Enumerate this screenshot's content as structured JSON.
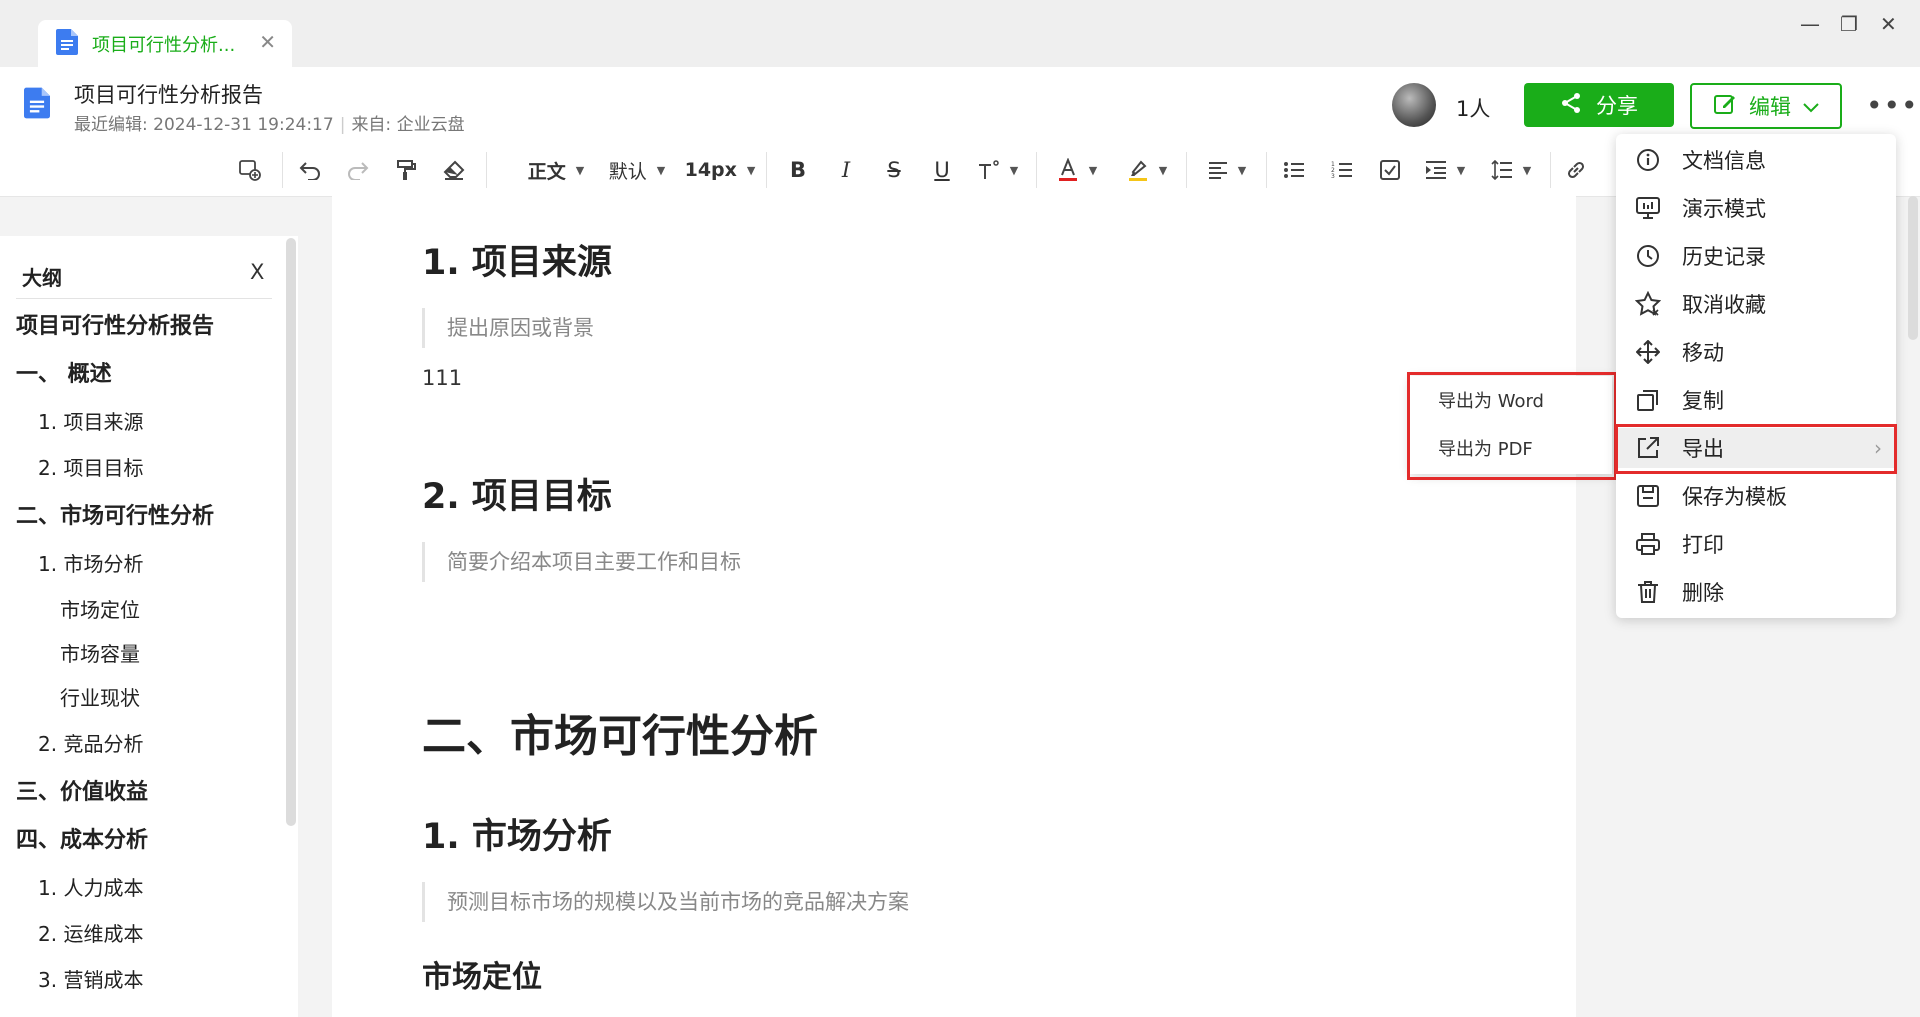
{
  "tab": {
    "title": "项目可行性分析...",
    "close": "✕"
  },
  "window": {
    "minimize": "—",
    "restore": "❐",
    "close": "✕"
  },
  "header": {
    "title": "项目可行性分析报告",
    "meta_edit_label": "最近编辑:",
    "meta_edit_time": "2024-12-31 19:24:17",
    "meta_source": "来自: 企业云盘",
    "people": "1人",
    "share": "分享",
    "edit": "编辑",
    "more": "•••"
  },
  "toolbar": {
    "style": "正文",
    "font": "默认",
    "size": "14px"
  },
  "outline": {
    "heading": "大纲",
    "close": "X",
    "items": [
      {
        "label": "项目可行性分析报告",
        "level": 0
      },
      {
        "label": "一、 概述",
        "level": 0
      },
      {
        "label": "1. 项目来源",
        "level": 1
      },
      {
        "label": "2. 项目目标",
        "level": 1
      },
      {
        "label": "二、市场可行性分析",
        "level": 0
      },
      {
        "label": "1. 市场分析",
        "level": 1
      },
      {
        "label": "市场定位",
        "level": 2
      },
      {
        "label": "市场容量",
        "level": 2
      },
      {
        "label": "行业现状",
        "level": 2
      },
      {
        "label": "2. 竞品分析",
        "level": 1
      },
      {
        "label": "三、价值收益",
        "level": 0
      },
      {
        "label": "四、成本分析",
        "level": 0
      },
      {
        "label": "1. 人力成本",
        "level": 1
      },
      {
        "label": "2. 运维成本",
        "level": 1
      },
      {
        "label": "3. 营销成本",
        "level": 1
      }
    ]
  },
  "document": {
    "h_source": "1. 项目来源",
    "q_source": "提出原因或背景",
    "p_111": "111",
    "h_goal": "2. 项目目标",
    "q_goal": "简要介绍本项目主要工作和目标",
    "h_market": "二、市场可行性分析",
    "h_market_analysis": "1. 市场分析",
    "q_market": "预测目标市场的规模以及当前市场的竞品解决方案",
    "h_positioning": "市场定位"
  },
  "export_submenu": {
    "word": "导出为 Word",
    "pdf": "导出为 PDF"
  },
  "menu": {
    "items": [
      {
        "label": "文档信息",
        "icon": "info-icon"
      },
      {
        "label": "演示模式",
        "icon": "presentation-icon"
      },
      {
        "label": "历史记录",
        "icon": "clock-icon"
      },
      {
        "label": "取消收藏",
        "icon": "star-icon"
      },
      {
        "label": "移动",
        "icon": "move-icon"
      },
      {
        "label": "复制",
        "icon": "copy-icon"
      },
      {
        "label": "导出",
        "icon": "export-icon"
      },
      {
        "label": "保存为模板",
        "icon": "save-icon"
      },
      {
        "label": "打印",
        "icon": "print-icon"
      },
      {
        "label": "删除",
        "icon": "trash-icon"
      }
    ],
    "export_arrow": "›"
  },
  "colors": {
    "brand_green": "#1aad19",
    "highlight_red": "#e32b2b",
    "font_color_red": "#e02020",
    "highlight_yellow": "#f5c518"
  }
}
